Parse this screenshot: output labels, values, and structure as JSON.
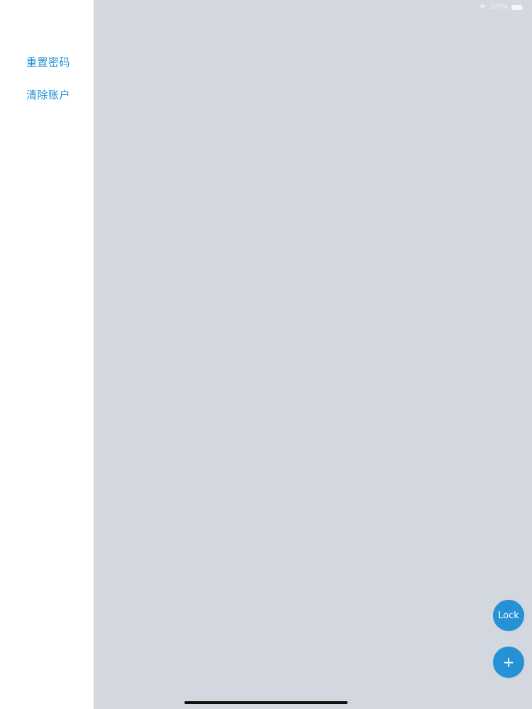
{
  "sidebar": {
    "items": [
      {
        "label": "重置密码"
      },
      {
        "label": "清除账户"
      }
    ]
  },
  "status_bar": {
    "battery_text": "100%",
    "icons": [
      "wifi-icon",
      "battery-icon"
    ]
  },
  "actions": {
    "lock_label": "Lock",
    "add_label": "+"
  },
  "colors": {
    "accent": "#1a8fd8",
    "fab": "#2492d5",
    "background": "#d3d7df",
    "sidebar": "#ffffff"
  }
}
